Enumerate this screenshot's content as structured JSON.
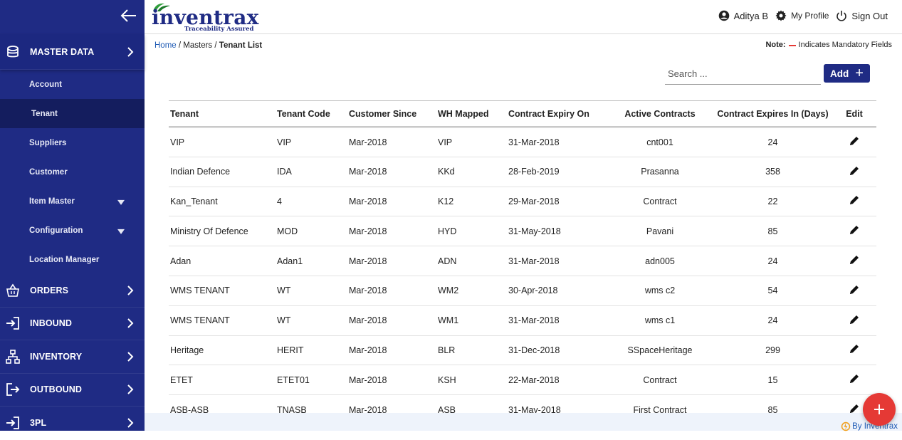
{
  "brand": {
    "name": "inventrax",
    "tagline": "Traceability Assured"
  },
  "header": {
    "user": "Aditya B",
    "profile": "My Profile",
    "signout": "Sign Out"
  },
  "sidebar": {
    "master": "MASTER DATA",
    "items": [
      {
        "label": "Account"
      },
      {
        "label": "Tenant"
      },
      {
        "label": "Suppliers"
      },
      {
        "label": "Customer"
      },
      {
        "label": "Item Master"
      },
      {
        "label": "Configuration"
      },
      {
        "label": "Location Manager"
      }
    ],
    "sections": [
      {
        "label": "ORDERS"
      },
      {
        "label": "INBOUND"
      },
      {
        "label": "INVENTORY"
      },
      {
        "label": "OUTBOUND"
      },
      {
        "label": "3PL"
      }
    ]
  },
  "breadcrumb": {
    "home": "Home",
    "masters": "Masters",
    "current": "Tenant List"
  },
  "note": {
    "label": "Note:",
    "text": "Indicates Mandatory Fields"
  },
  "search": {
    "placeholder": "Search ..."
  },
  "add_label": "Add",
  "table": {
    "headers": [
      "Tenant",
      "Tenant Code",
      "Customer Since",
      "WH Mapped",
      "Contract Expiry On",
      "Active Contracts",
      "Contract Expires In (Days)",
      "Edit"
    ],
    "rows": [
      [
        "VIP",
        "VIP",
        "Mar-2018",
        "VIP",
        "31-Mar-2018",
        "cnt001",
        "24"
      ],
      [
        "Indian Defence",
        "IDA",
        "Mar-2018",
        "KKd",
        "28-Feb-2019",
        "Prasanna",
        "358"
      ],
      [
        "Kan_Tenant",
        "4",
        "Mar-2018",
        "K12",
        "29-Mar-2018",
        "Contract",
        "22"
      ],
      [
        "Ministry Of Defence",
        "MOD",
        "Mar-2018",
        "HYD",
        "31-May-2018",
        "Pavani",
        "85"
      ],
      [
        "Adan",
        "Adan1",
        "Mar-2018",
        "ADN",
        "31-Mar-2018",
        "adn005",
        "24"
      ],
      [
        "WMS TENANT",
        "WT",
        "Mar-2018",
        "WM2",
        "30-Apr-2018",
        "wms c2",
        "54"
      ],
      [
        "WMS TENANT",
        "WT",
        "Mar-2018",
        "WM1",
        "31-Mar-2018",
        "wms c1",
        "24"
      ],
      [
        "Heritage",
        "HERIT",
        "Mar-2018",
        "BLR",
        "31-Dec-2018",
        "SSpaceHeritage",
        "299"
      ],
      [
        "ETET",
        "ETET01",
        "Mar-2018",
        "KSH",
        "22-Mar-2018",
        "Contract",
        "15"
      ],
      [
        "ASB-ASB",
        "TNASB",
        "Mar-2018",
        "ASB",
        "31-May-2018",
        "First Contract",
        "85"
      ]
    ]
  },
  "footer": {
    "byline": "By Inventrax"
  },
  "colors": {
    "sidebar": "#1f2b84",
    "accent": "#1f2b84",
    "fab": "#e53935",
    "link": "#1f5bb5"
  }
}
